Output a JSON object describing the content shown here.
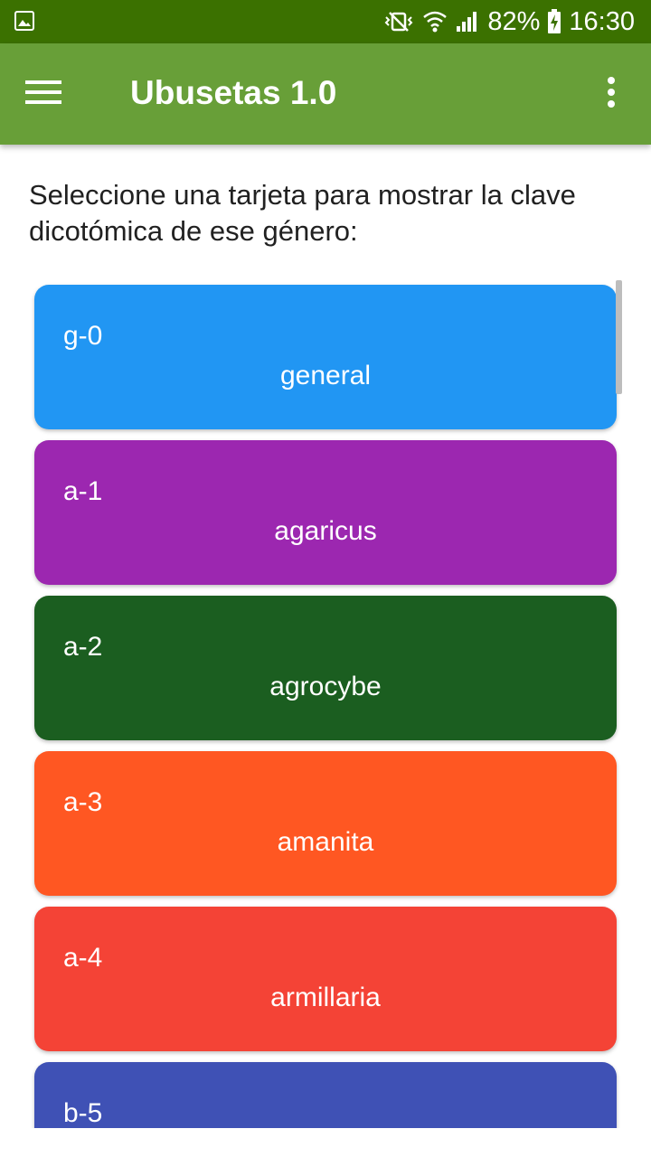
{
  "status_bar": {
    "battery": "82%",
    "time": "16:30",
    "icons": [
      "image-notification-icon",
      "mute-vibrate-icon",
      "wifi-icon",
      "signal-icon",
      "battery-charging-icon"
    ]
  },
  "app_bar": {
    "title": "Ubusetas 1.0",
    "menu_icon": "hamburger-menu-icon",
    "overflow_icon": "more-vert-icon"
  },
  "instructions": "Seleccione una tarjeta para mostrar la clave dicotómica de ese género:",
  "colors": {
    "status_bar": "#3b7100",
    "app_bar": "#689f38"
  },
  "cards": [
    {
      "code": "g-0",
      "name": "general",
      "color": "#2196f3"
    },
    {
      "code": "a-1",
      "name": "agaricus",
      "color": "#9c27b0"
    },
    {
      "code": "a-2",
      "name": "agrocybe",
      "color": "#1b5e20"
    },
    {
      "code": "a-3",
      "name": "amanita",
      "color": "#ff5722"
    },
    {
      "code": "a-4",
      "name": "armillaria",
      "color": "#f44336"
    },
    {
      "code": "b-5",
      "name": "",
      "color": "#3f51b5"
    }
  ]
}
